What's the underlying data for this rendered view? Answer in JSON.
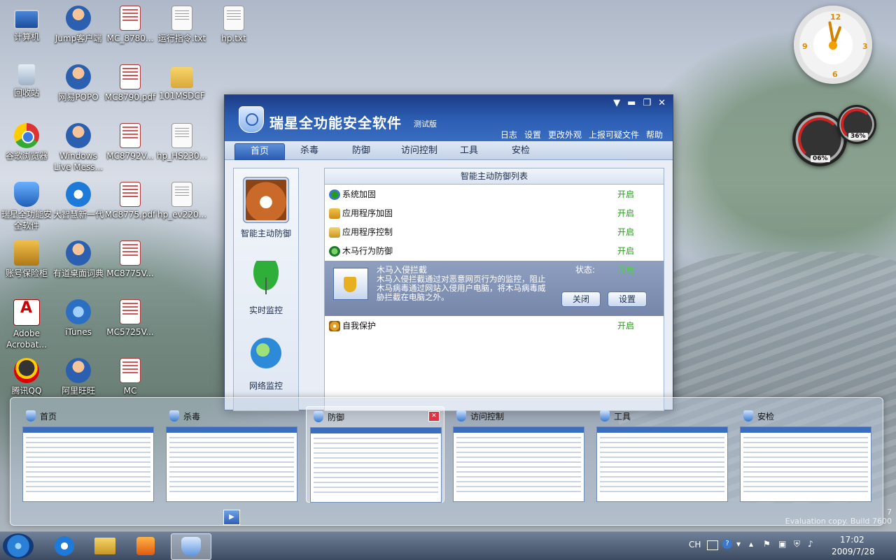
{
  "desktop_icons": [
    {
      "label": "计算机",
      "icon": "pc-icon"
    },
    {
      "label": "Jump客户端",
      "icon": "person-icon"
    },
    {
      "label": "MC_8780...",
      "icon": "pdf-icon"
    },
    {
      "label": "运行指令.txt",
      "icon": "doc-icon"
    },
    {
      "label": "hp.txt",
      "icon": "doc-icon"
    },
    {
      "label": "回收站",
      "icon": "bin-icon"
    },
    {
      "label": "网易POPO",
      "icon": "person-icon"
    },
    {
      "label": "MC8790.pdf",
      "icon": "pdf-icon"
    },
    {
      "label": "101MSDCF",
      "icon": "folder-icon"
    },
    {
      "label": "谷歌浏览器",
      "icon": "chrome-icon"
    },
    {
      "label": "Windows Live Mess...",
      "icon": "person-icon"
    },
    {
      "label": "MC8792V...",
      "icon": "pdf-icon"
    },
    {
      "label": "hp_HS230...",
      "icon": "doc-icon"
    },
    {
      "label": "瑞星全功能安全软件",
      "icon": "shield-icon"
    },
    {
      "label": "大智慧新一代",
      "icon": "ie-icon"
    },
    {
      "label": "MC8775.pdf",
      "icon": "pdf-icon"
    },
    {
      "label": "hp_ev220...",
      "icon": "doc-icon"
    },
    {
      "label": "账号保险柜",
      "icon": "safe-icon"
    },
    {
      "label": "有道桌面词典",
      "icon": "person-icon"
    },
    {
      "label": "MC8775V...",
      "icon": "pdf-icon"
    },
    {
      "label": "Adobe Acrobat...",
      "icon": "adobe-icon"
    },
    {
      "label": "iTunes",
      "icon": "itunes-icon"
    },
    {
      "label": "MC5725V...",
      "icon": "pdf-icon"
    },
    {
      "label": "腾讯QQ",
      "icon": "qq-icon"
    },
    {
      "label": "阿里旺旺",
      "icon": "person-icon"
    },
    {
      "label": "MC",
      "icon": "pdf-icon"
    }
  ],
  "gadgets": {
    "clock_numbers": [
      "12",
      "3",
      "6",
      "9"
    ],
    "cpu_percent": "06%",
    "mem_percent": "36%"
  },
  "app": {
    "title": "瑞星全功能安全软件",
    "edition": "测试版",
    "window_controls": [
      "▼",
      "▬",
      "❐",
      "✕"
    ],
    "top_links": [
      "日志",
      "设置",
      "更改外观",
      "上报可疑文件",
      "帮助"
    ],
    "tabs": [
      "首页",
      "杀毒",
      "防御",
      "访问控制",
      "工具",
      "安检"
    ],
    "active_tab": "首页",
    "sidebar": [
      "智能主动防御",
      "实时监控",
      "网络监控"
    ],
    "panel_title": "智能主动防御列表",
    "rows": [
      {
        "label": "系统加固",
        "status": "开启"
      },
      {
        "label": "应用程序加固",
        "status": "开启"
      },
      {
        "label": "应用程序控制",
        "status": "开启"
      },
      {
        "label": "木马行为防御",
        "status": "开启"
      }
    ],
    "expanded": {
      "title": "木马入侵拦截",
      "desc": "木马入侵拦截通过对恶意网页行为的监控，阻止木马病毒通过网站入侵用户电脑，将木马病毒威胁拦截在电脑之外。",
      "status_label": "状态:",
      "status_value": "开启",
      "btn_close": "关闭",
      "btn_settings": "设置"
    },
    "self_protect": {
      "label": "自我保护",
      "status": "开启"
    }
  },
  "thumbnails": [
    "首页",
    "杀毒",
    "防御",
    "访问控制",
    "工具",
    "安检"
  ],
  "taskbar": {
    "lang": "CH",
    "time": "17:02",
    "date": "2009/7/28",
    "watermark": "Evaluation copy. Build 7600",
    "watermark_num": "7"
  }
}
